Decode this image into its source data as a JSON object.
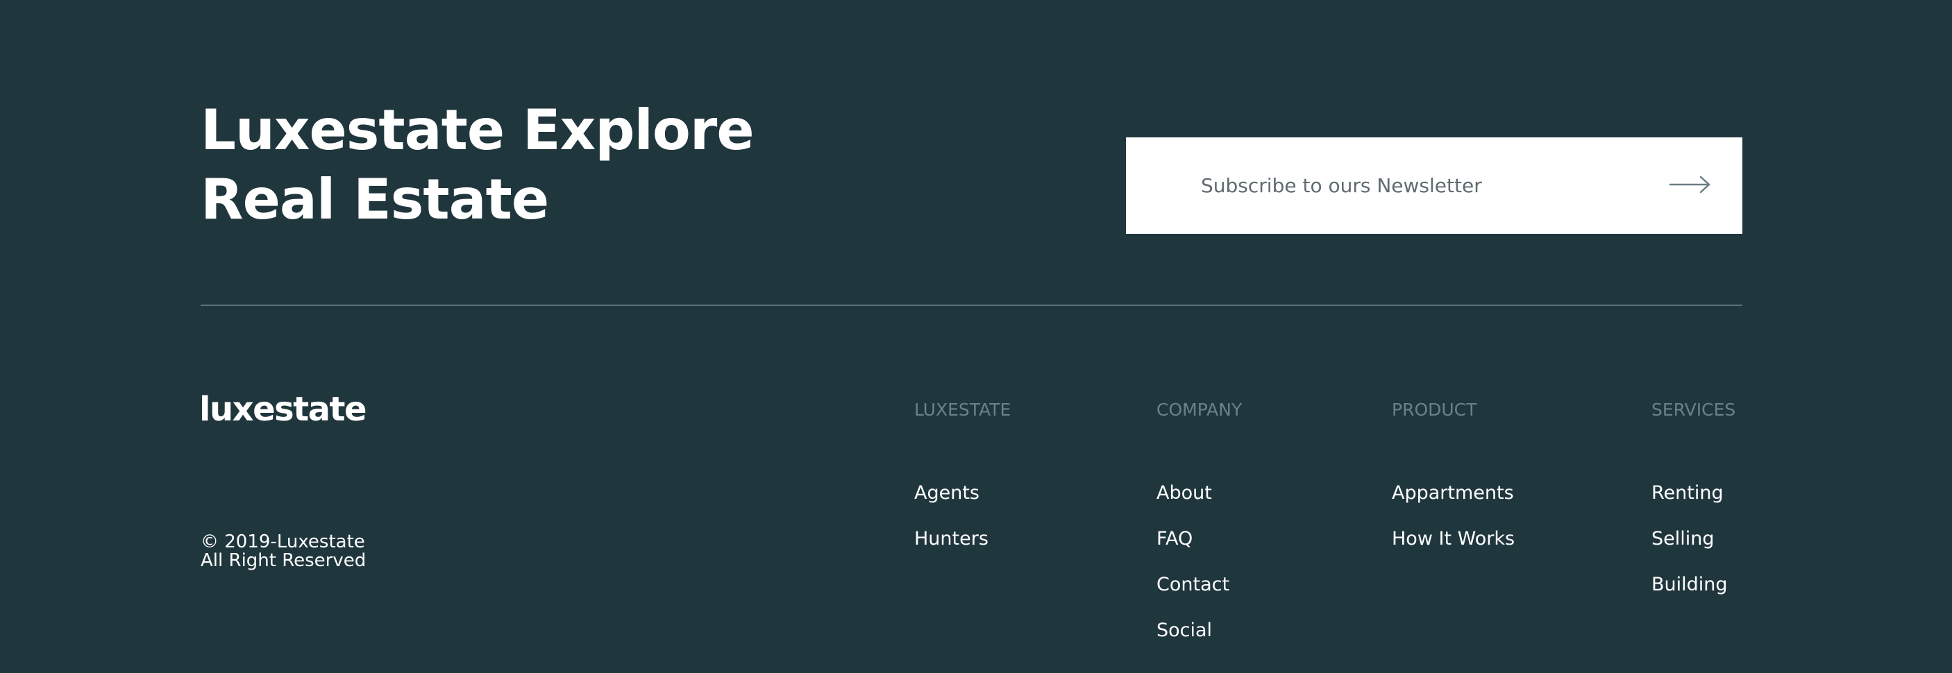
{
  "hero": {
    "title_line1": "Luxestate Explore",
    "title_line2": "Real Estate"
  },
  "newsletter": {
    "placeholder": "Subscribe to ours Newsletter",
    "submit_icon": "arrow-right-icon"
  },
  "brand": {
    "logo_text": "luxestate",
    "copyright_line1": "© 2019-Luxestate",
    "copyright_line2": "All Right Reserved"
  },
  "footer": {
    "columns": [
      {
        "heading": "LUXESTATE",
        "links": [
          "Agents",
          "Hunters"
        ]
      },
      {
        "heading": "COMPANY",
        "links": [
          "About",
          "FAQ",
          "Contact",
          "Social"
        ]
      },
      {
        "heading": "PRODUCT",
        "links": [
          "Appartments",
          "How It Works"
        ]
      },
      {
        "heading": "SERVICES",
        "links": [
          "Renting",
          "Selling",
          "Building"
        ]
      }
    ]
  },
  "colors": {
    "background": "#20363d",
    "muted_heading": "#6c8087",
    "divider": "#5e7278",
    "text": "#ffffff"
  }
}
